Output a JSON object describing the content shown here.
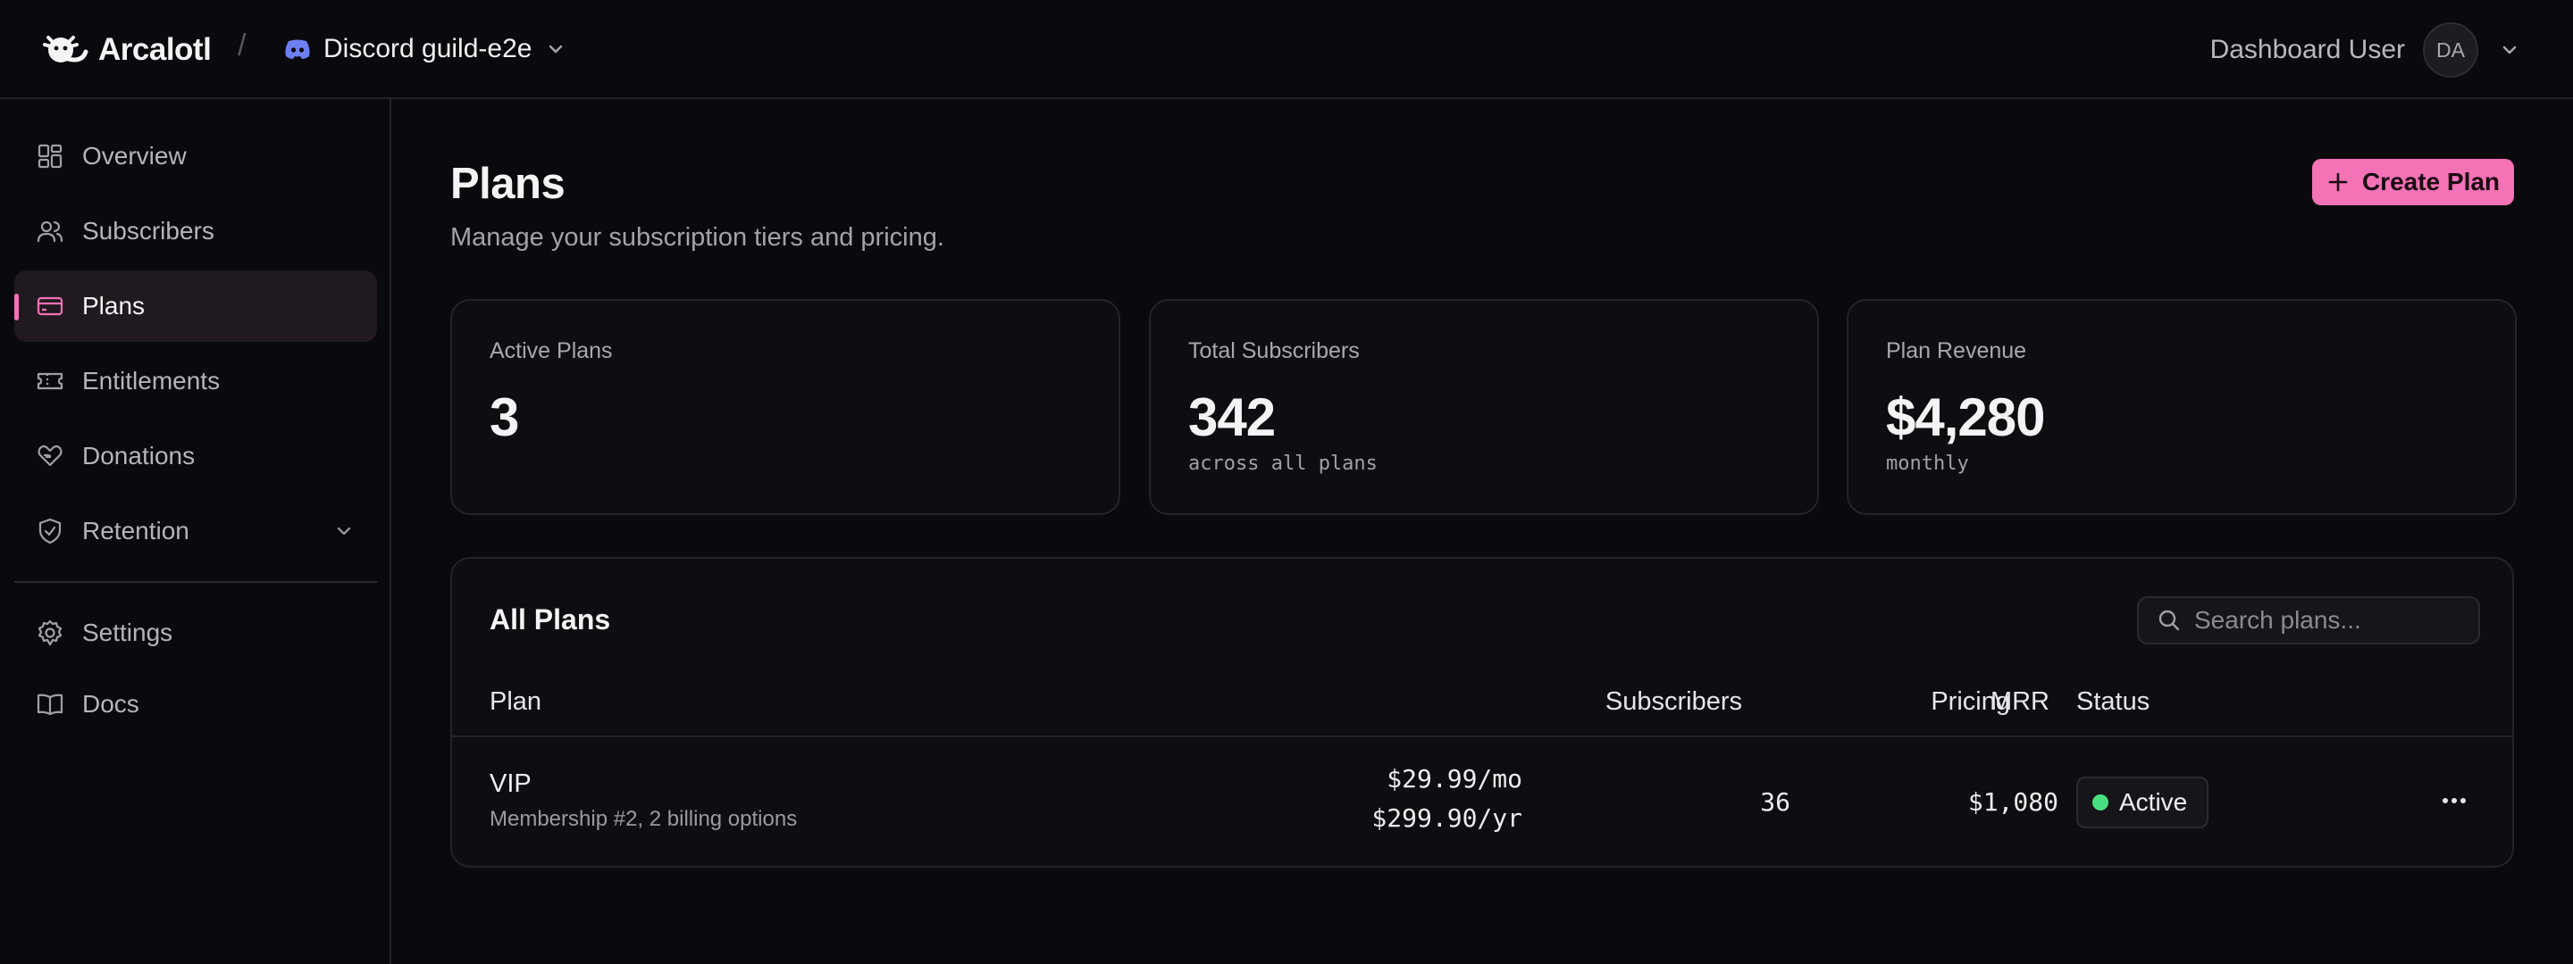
{
  "header": {
    "brand": "Arcalotl",
    "separator": "/",
    "guild_name": "Discord guild-e2e",
    "user_name": "Dashboard User",
    "user_initials": "DA"
  },
  "sidebar": {
    "items": [
      {
        "label": "Overview",
        "icon": "grid-icon"
      },
      {
        "label": "Subscribers",
        "icon": "users-icon"
      },
      {
        "label": "Plans",
        "icon": "credit-card-icon",
        "active": true
      },
      {
        "label": "Entitlements",
        "icon": "ticket-icon"
      },
      {
        "label": "Donations",
        "icon": "heart-hand-icon"
      },
      {
        "label": "Retention",
        "icon": "shield-check-icon",
        "expandable": true
      }
    ],
    "bottom_items": [
      {
        "label": "Settings",
        "icon": "gear-icon"
      },
      {
        "label": "Docs",
        "icon": "book-icon"
      }
    ]
  },
  "page": {
    "title": "Plans",
    "subtitle": "Manage your subscription tiers and pricing.",
    "create_label": "Create Plan"
  },
  "stats": [
    {
      "label": "Active Plans",
      "value": "3",
      "note": ""
    },
    {
      "label": "Total Subscribers",
      "value": "342",
      "note": "across all plans"
    },
    {
      "label": "Plan Revenue",
      "value": "$4,280",
      "note": "monthly"
    }
  ],
  "table": {
    "title": "All Plans",
    "search_placeholder": "Search plans...",
    "columns": [
      "Plan",
      "Pricing",
      "Subscribers",
      "MRR",
      "Status"
    ],
    "rows": [
      {
        "name": "VIP",
        "description": "Membership #2, 2 billing options",
        "price_monthly": "$29.99/mo",
        "price_yearly": "$299.90/yr",
        "subscribers": "36",
        "mrr": "$1,080",
        "status": "Active"
      }
    ]
  },
  "colors": {
    "accent": "#f472b6",
    "background": "#0a0a0e",
    "status_active": "#4ade80"
  }
}
